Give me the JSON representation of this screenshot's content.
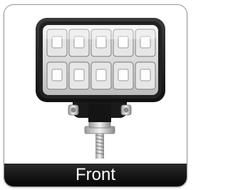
{
  "caption": {
    "text": "Front",
    "bar_color": "#0b0b0b",
    "text_color": "#ffffff"
  },
  "product": {
    "name_icon": "led-work-light-icon",
    "led_count": 10
  }
}
